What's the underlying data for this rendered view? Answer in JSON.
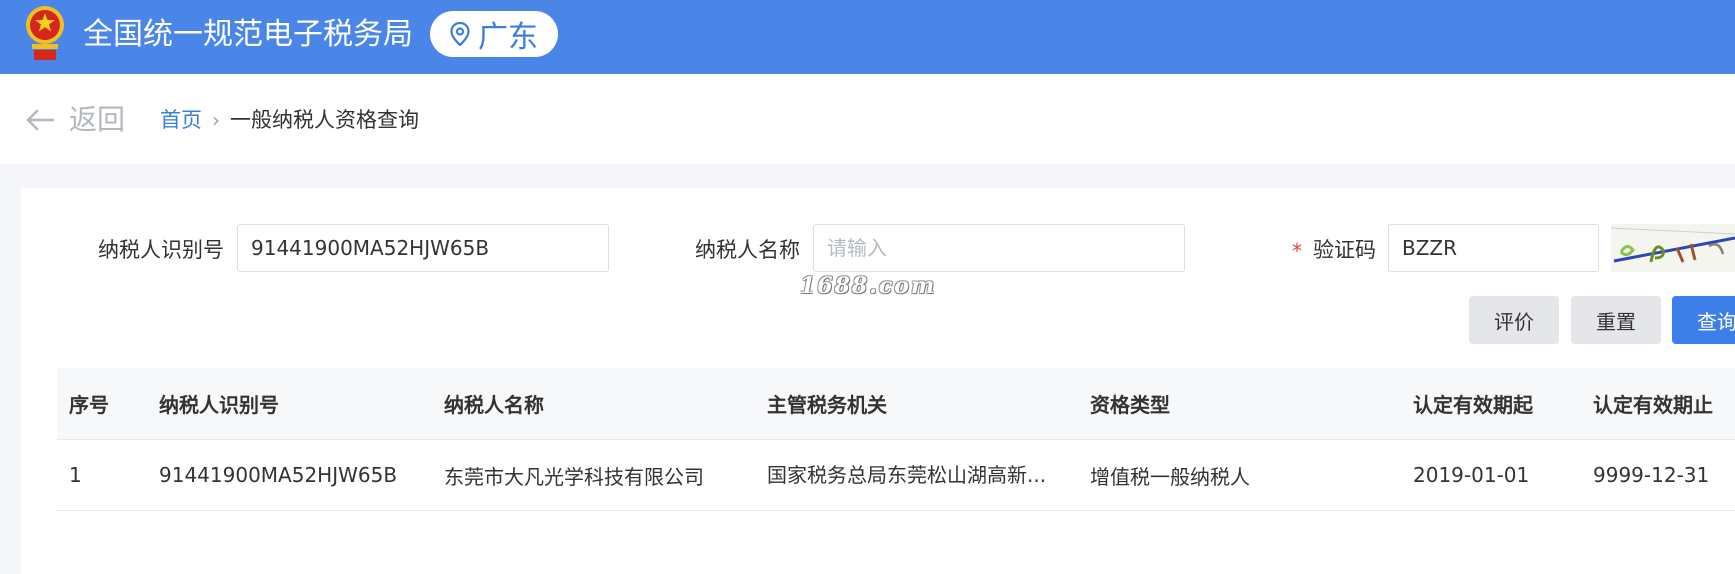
{
  "header": {
    "site_title": "全国统一规范电子税务局",
    "region": "广东",
    "emblem_icon": "national-emblem-icon",
    "location_icon": "location-pin-icon",
    "bg_color": "#4a86e8"
  },
  "nav": {
    "back_label": "返回",
    "breadcrumb": {
      "home": "首页",
      "separator": "›",
      "current": "一般纳税人资格查询"
    }
  },
  "form": {
    "taxpayer_id_label": "纳税人识别号",
    "taxpayer_id_value": "91441900MA52HJW65B",
    "taxpayer_name_label": "纳税人名称",
    "taxpayer_name_value": "",
    "taxpayer_name_placeholder": "请输入",
    "captcha_required_mark": "*",
    "captcha_label": "验证码",
    "captcha_value": "BZZR"
  },
  "buttons": {
    "evaluate": "评价",
    "reset": "重置",
    "query": "查询"
  },
  "watermark": "1688.com",
  "table": {
    "columns": [
      "序号",
      "纳税人识别号",
      "纳税人名称",
      "主管税务机关",
      "资格类型",
      "认定有效期起",
      "认定有效期止"
    ],
    "rows": [
      [
        "1",
        "91441900MA52HJW65B",
        "东莞市大凡光学科技有限公司",
        "国家税务总局东莞松山湖高新...",
        "增值税一般纳税人",
        "2019-01-01",
        "9999-12-31"
      ]
    ]
  },
  "colors": {
    "primary": "#3d7fe9",
    "link": "#3a7de0",
    "required": "#e0443a"
  }
}
